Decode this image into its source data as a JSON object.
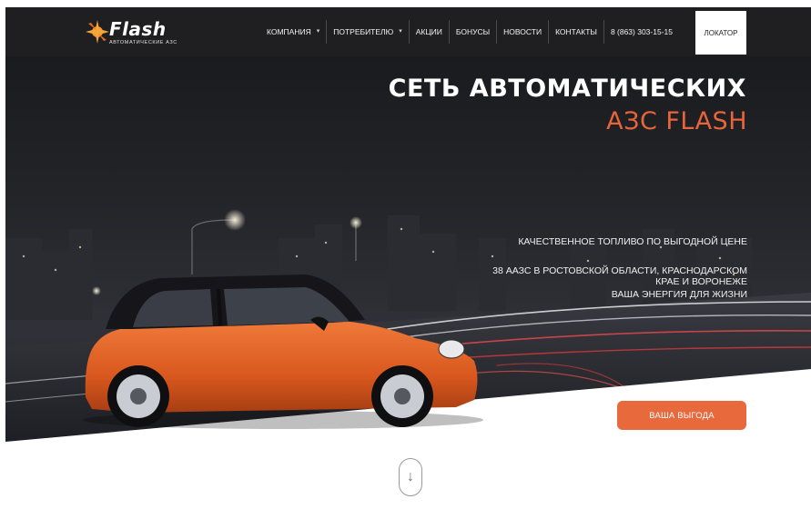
{
  "header": {
    "logo": {
      "word": "Flash",
      "subtitle": "АВТОМАТИЧЕСКИЕ АЗС"
    },
    "nav": [
      {
        "label": "КОМПАНИЯ",
        "dropdown": true
      },
      {
        "label": "ПОТРЕБИТЕЛЮ",
        "dropdown": true
      },
      {
        "label": "АКЦИИ",
        "dropdown": false
      },
      {
        "label": "БОНУСЫ",
        "dropdown": false
      },
      {
        "label": "НОВОСТИ",
        "dropdown": false
      },
      {
        "label": "КОНТАКТЫ",
        "dropdown": false
      },
      {
        "label": "8 (863) 303-15-15",
        "dropdown": false
      }
    ],
    "locator_label": "ЛОКАТОР"
  },
  "hero": {
    "title_line1": "СЕТЬ АВТОМАТИЧЕСКИХ",
    "title_line2": "АЗС FLASH",
    "tagline1": "КАЧЕСТВЕННОЕ ТОПЛИВО ПО ВЫГОДНОЙ ЦЕНЕ",
    "tagline2": "38 ААЗС В РОСТОВСКОЙ ОБЛАСТИ, КРАСНОДАРСКОМ КРАЕ И ВОРОНЕЖЕ",
    "tagline3": "ВАША ЭНЕРГИЯ ДЛЯ ЖИЗНИ",
    "cta_label": "ВАША ВЫГОДА"
  },
  "scroll": {
    "icon": "arrow-down-icon",
    "glyph": "↓"
  },
  "colors": {
    "accent": "#e8643a",
    "header_bg": "#1f1f21",
    "button": "#e8693c"
  }
}
